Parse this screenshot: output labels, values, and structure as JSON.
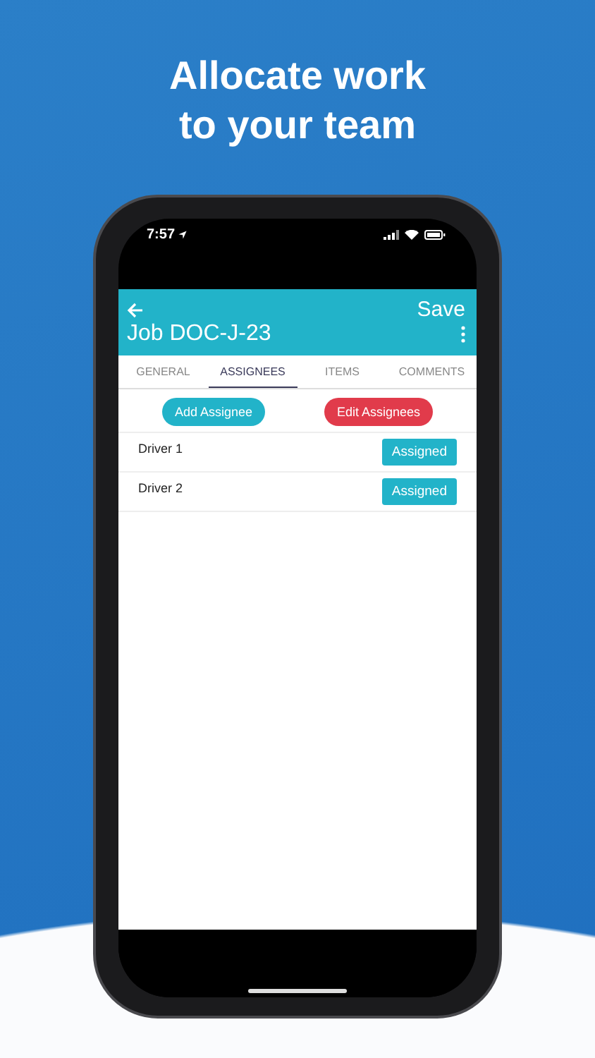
{
  "headline": [
    "Allocate work",
    "to your team"
  ],
  "status_bar": {
    "time": "7:57"
  },
  "header": {
    "save": "Save",
    "title": "Job DOC-J-23"
  },
  "tabs": [
    {
      "label": "GENERAL",
      "selected": false
    },
    {
      "label": "ASSIGNEES",
      "selected": true
    },
    {
      "label": "ITEMS",
      "selected": false
    },
    {
      "label": "COMMENTS",
      "selected": false
    }
  ],
  "actions": [
    {
      "label": "Add Assignee",
      "kind": "primary"
    },
    {
      "label": "Edit Assignees",
      "kind": "danger"
    }
  ],
  "assignees": [
    {
      "name": "Driver 1",
      "status": "Assigned"
    },
    {
      "name": "Driver 2",
      "status": "Assigned"
    }
  ]
}
